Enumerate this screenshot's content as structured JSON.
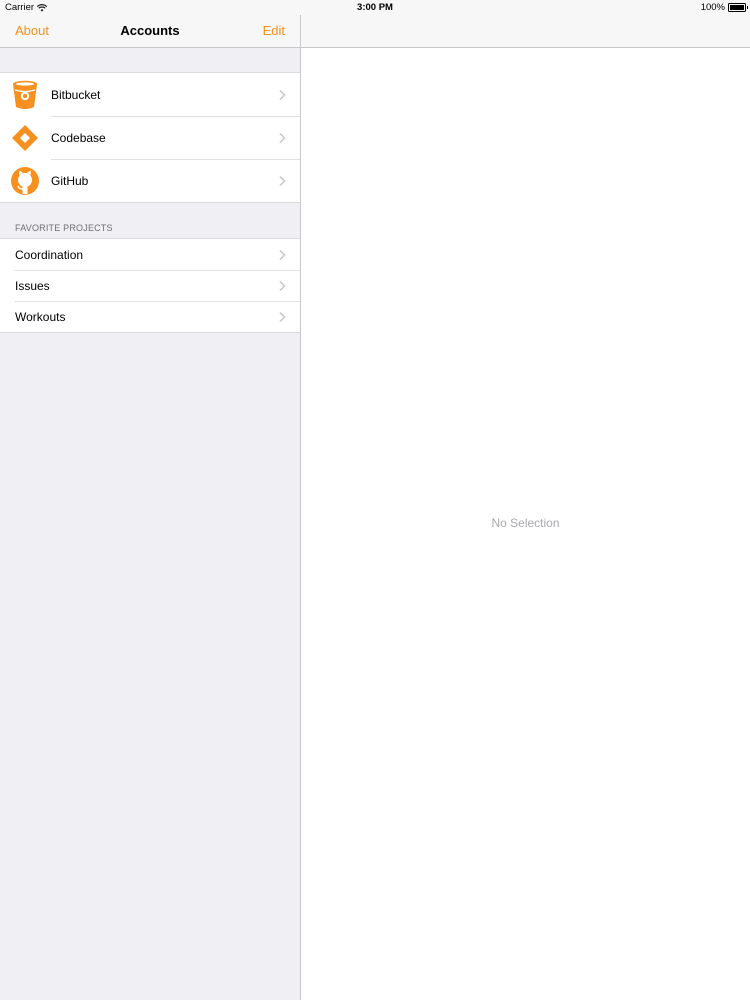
{
  "status_bar": {
    "carrier": "Carrier",
    "time": "3:00 PM",
    "battery": "100%"
  },
  "master": {
    "nav": {
      "left_button": "About",
      "title": "Accounts",
      "right_button": "Edit"
    },
    "accounts": [
      {
        "label": "Bitbucket",
        "icon": "bitbucket-icon"
      },
      {
        "label": "Codebase",
        "icon": "codebase-icon"
      },
      {
        "label": "GitHub",
        "icon": "github-icon"
      }
    ],
    "favorites_header": "FAVORITE PROJECTS",
    "favorites": [
      {
        "label": "Coordination"
      },
      {
        "label": "Issues"
      },
      {
        "label": "Workouts"
      }
    ]
  },
  "detail": {
    "placeholder": "No Selection"
  },
  "colors": {
    "accent": "#f7901e",
    "background": "#efeff4",
    "separator": "#c8c7cc",
    "chevron": "#c7c7cc"
  }
}
